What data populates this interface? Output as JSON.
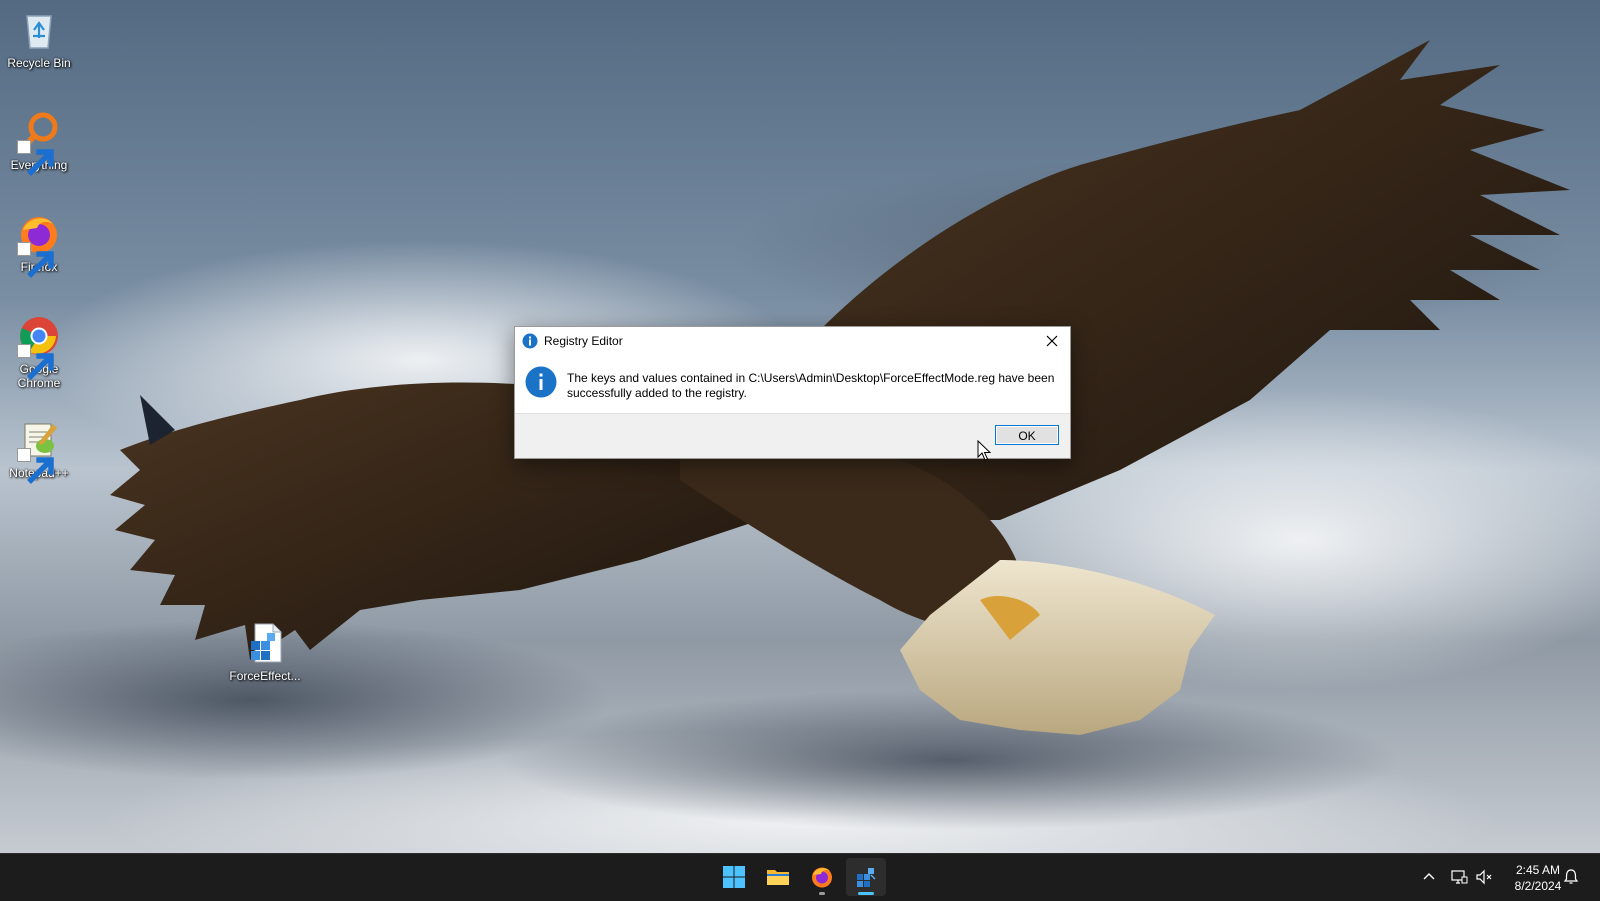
{
  "desktop": {
    "icons": [
      {
        "name": "recycle-bin",
        "label": "Recycle Bin",
        "icon": "recycle-bin-icon"
      },
      {
        "name": "everything",
        "label": "Everything",
        "icon": "magnifier-icon"
      },
      {
        "name": "firefox",
        "label": "Firefox",
        "icon": "firefox-icon"
      },
      {
        "name": "google-chrome",
        "label": "Google Chrome",
        "icon": "chrome-icon"
      },
      {
        "name": "notepad-plus-plus",
        "label": "Notepad++",
        "icon": "notepad-plus-plus-icon"
      },
      {
        "name": "force-effect-file",
        "label": "ForceEffect...",
        "icon": "registry-file-icon"
      }
    ]
  },
  "dialog": {
    "title": "Registry Editor",
    "message": "The keys and values contained in C:\\Users\\Admin\\Desktop\\ForceEffectMode.reg have been successfully added to the registry.",
    "ok_label": "OK",
    "icon": "info-icon",
    "close_icon": "close-icon"
  },
  "taskbar": {
    "apps": [
      {
        "name": "start",
        "icon": "windows-logo-icon"
      },
      {
        "name": "file-explorer",
        "icon": "folder-icon"
      },
      {
        "name": "firefox",
        "icon": "firefox-icon"
      },
      {
        "name": "registry-editor",
        "icon": "registry-editor-icon",
        "active": true
      }
    ],
    "tray": {
      "icons": [
        "chevron-up-icon",
        "network-icon",
        "speaker-muted-icon",
        "bell-icon"
      ],
      "time": "2:45 AM",
      "date": "8/2/2024"
    }
  },
  "colors": {
    "accent": "#0078d4",
    "taskbar": "#1c1c1c",
    "info_blue": "#1a73c7"
  }
}
